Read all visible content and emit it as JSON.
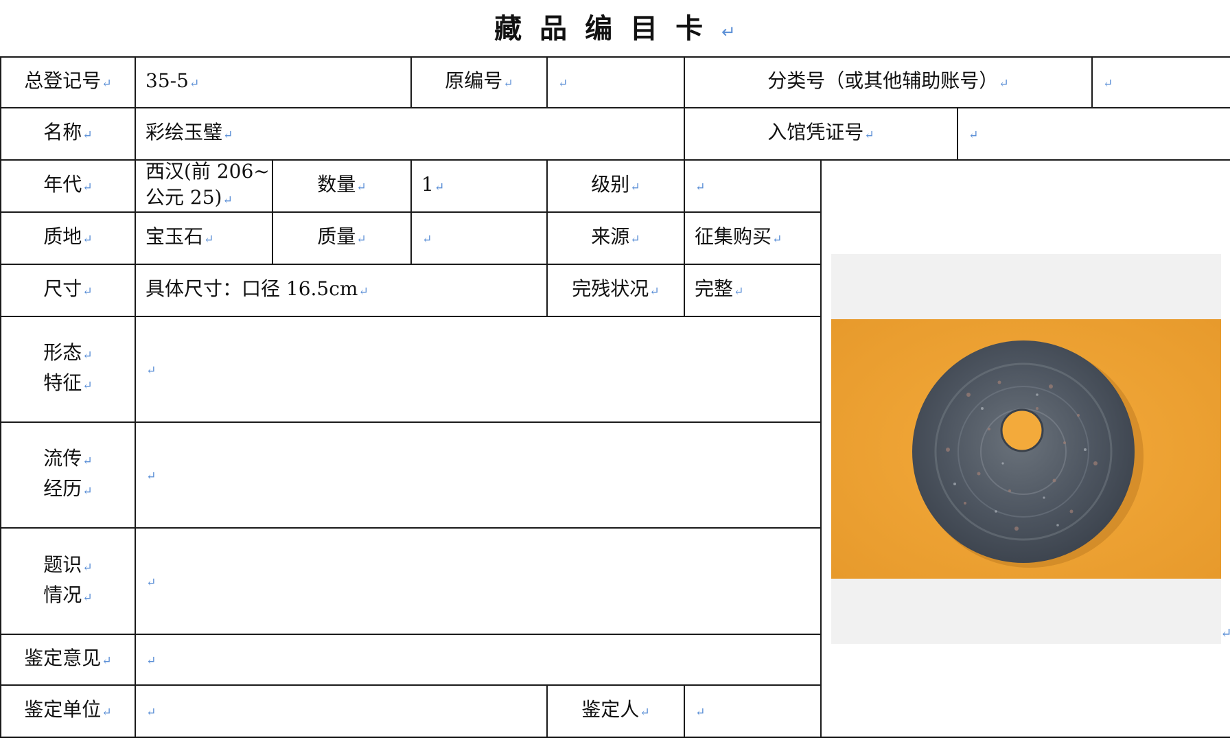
{
  "title": "藏品编目卡",
  "return_mark": "↵",
  "labels": {
    "reg_no": "总登记号",
    "orig_no": "原编号",
    "class_no": "分类号（或其他辅助账号）",
    "name": "名称",
    "entry_no": "入馆凭证号",
    "era": "年代",
    "quantity": "数量",
    "grade": "级别",
    "material": "质地",
    "weight": "质量",
    "source": "来源",
    "size": "尺寸",
    "condition": "完残状况",
    "form_1": "形态",
    "form_2": "特征",
    "history_1": "流传",
    "history_2": "经历",
    "inscription_1": "题识",
    "inscription_2": "情况",
    "appraisal_opinion": "鉴定意见",
    "appraisal_unit": "鉴定单位",
    "appraiser": "鉴定人"
  },
  "values": {
    "reg_no": "35-5",
    "orig_no": "",
    "class_no": "",
    "name": "彩绘玉璧",
    "entry_no": "",
    "era_1": "西汉(前 206~",
    "era_2": "公元 25)",
    "quantity": "1",
    "grade": "",
    "material": "宝玉石",
    "weight": "",
    "source": "征集购买",
    "size": "具体尺寸：口径 16.5cm",
    "condition": "完整",
    "form": "",
    "history": "",
    "inscription": "",
    "appraisal_opinion": "",
    "appraisal_unit": "",
    "appraiser": ""
  },
  "photo": {
    "subject": "jade-bi-disc",
    "background_color": "#eea131",
    "disc_color": "#4e5661"
  }
}
